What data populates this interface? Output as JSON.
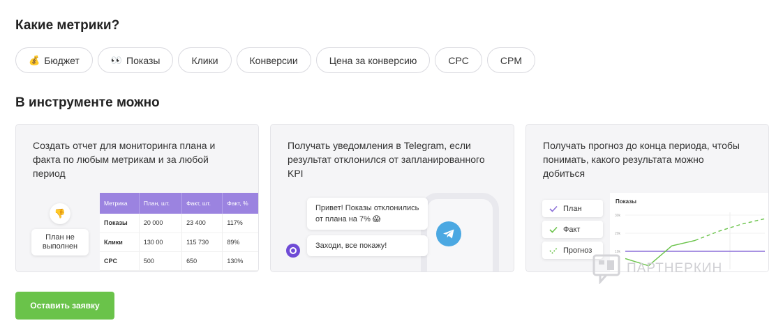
{
  "metrics_heading": "Какие метрики?",
  "chips": [
    {
      "icon": "💰",
      "icon_name": "money-bag-icon",
      "label": "Бюджет"
    },
    {
      "icon": "👀",
      "icon_name": "eyes-icon",
      "label": "Показы"
    },
    {
      "icon": "",
      "label": "Клики"
    },
    {
      "icon": "",
      "label": "Конверсии"
    },
    {
      "icon": "",
      "label": "Цена за конверсию"
    },
    {
      "icon": "",
      "label": "CPC"
    },
    {
      "icon": "",
      "label": "CPM"
    }
  ],
  "tool_heading": "В инструменте можно",
  "cards": [
    {
      "text": "Создать отчет для мониторинга плана и факта по любым метрикам и за любой период"
    },
    {
      "text": "Получать уведомления в Telegram, если результат отклонился от запланированного KPI"
    },
    {
      "text": "Получать прогноз до конца периода, чтобы понимать, какого результата можно добиться"
    }
  ],
  "card1": {
    "thumb_icon": "👎",
    "plan_bubble": "План не выполнен",
    "table": {
      "headers": [
        "Метрика",
        "План, шт.",
        "Факт, шт.",
        "Факт, %"
      ],
      "rows": [
        [
          "Показы",
          "20 000",
          "23 400",
          "117%"
        ],
        [
          "Клики",
          "130 00",
          "115 730",
          "89%"
        ],
        [
          "CPC",
          "500",
          "650",
          "130%"
        ]
      ],
      "status": [
        "ok",
        "bad",
        "ok"
      ]
    }
  },
  "card2": {
    "message1": "Привет! Показы отклонились от плана на 7% 😱",
    "message2": "Заходи, все покажу!"
  },
  "card3": {
    "legend": [
      "План",
      "Факт",
      "Прогноз"
    ],
    "chart_title": "Показы",
    "y_ticks": [
      "30k",
      "20k",
      "10k"
    ]
  },
  "chart_data": {
    "type": "line",
    "title": "Показы",
    "y_ticks": [
      "10k",
      "20k",
      "30k"
    ],
    "ylim": [
      0,
      30000
    ],
    "x": [
      1,
      2,
      3,
      4,
      5,
      6,
      7
    ],
    "series": [
      {
        "name": "План",
        "values": [
          10000,
          10000,
          10000,
          10000,
          10000,
          10000,
          10000
        ],
        "color": "#8b6fd8"
      },
      {
        "name": "Факт",
        "values": [
          6000,
          2000,
          13000,
          16000,
          null,
          null,
          null
        ],
        "color": "#6ac34a"
      },
      {
        "name": "Прогноз",
        "values": [
          null,
          null,
          null,
          16000,
          21000,
          25000,
          28000
        ],
        "color": "#6ac34a"
      }
    ]
  },
  "watermark": "ПАРТНЕРКИН",
  "cta_label": "Оставить заявку",
  "colors": {
    "accent_purple": "#9b83e0",
    "green": "#6ac34a",
    "red": "#e0314b",
    "telegram": "#4ba8e2"
  }
}
